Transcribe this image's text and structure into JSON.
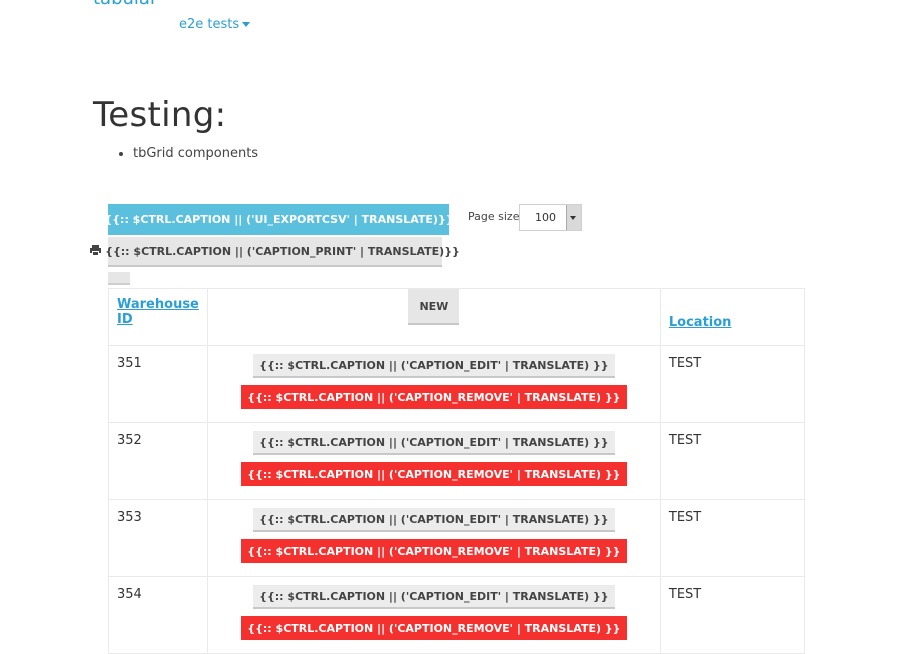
{
  "header": {
    "brand": "tabular",
    "nav_dropdown": "e2e tests"
  },
  "main": {
    "title": "Testing:",
    "components": [
      "tbGrid components"
    ]
  },
  "toolbar": {
    "export_label": "{{:: $ctrl.caption || ('UI_EXPORTCSV' | translate)}}",
    "export_icon": "download-icon",
    "print_label": "{{:: $ctrl.caption || ('CAPTION_PRINT' | translate)}}",
    "print_icon": "print-icon",
    "page_size_label": "Page size:",
    "page_size_value": "100"
  },
  "grid": {
    "headers": {
      "warehouse": "Warehouse ID",
      "new_button": "NEW",
      "location": "Location"
    },
    "edit_label": "{{:: $ctrl.caption || ('CAPTION_EDIT' | translate) }}",
    "remove_label": "{{:: $ctrl.caption || ('CAPTION_REMOVE' | translate) }}",
    "rows": [
      {
        "id": "351",
        "location": "TEST"
      },
      {
        "id": "352",
        "location": "TEST"
      },
      {
        "id": "353",
        "location": "TEST"
      },
      {
        "id": "354",
        "location": "TEST"
      }
    ]
  },
  "colors": {
    "link": "#2a9fd6",
    "export_button": "#5bc0de",
    "remove_button": "#f5312f",
    "default_button": "#e6e6e6"
  }
}
